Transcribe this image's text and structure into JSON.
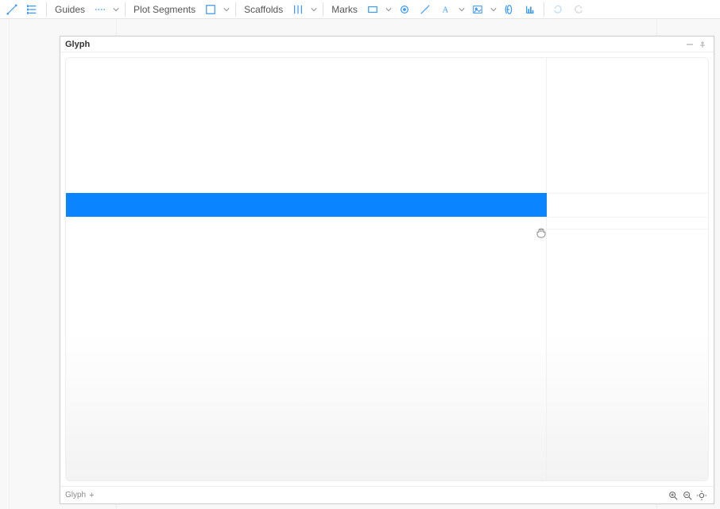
{
  "toolbar": {
    "groups": {
      "guides": {
        "label": "Guides"
      },
      "plot_segments": {
        "label": "Plot Segments"
      },
      "scaffolds": {
        "label": "Scaffolds"
      },
      "marks": {
        "label": "Marks"
      }
    }
  },
  "panel": {
    "title": "Glyph",
    "footer_tab": "Glyph"
  },
  "colors": {
    "accent": "#0a84ff",
    "icon": "#3b99fc"
  }
}
